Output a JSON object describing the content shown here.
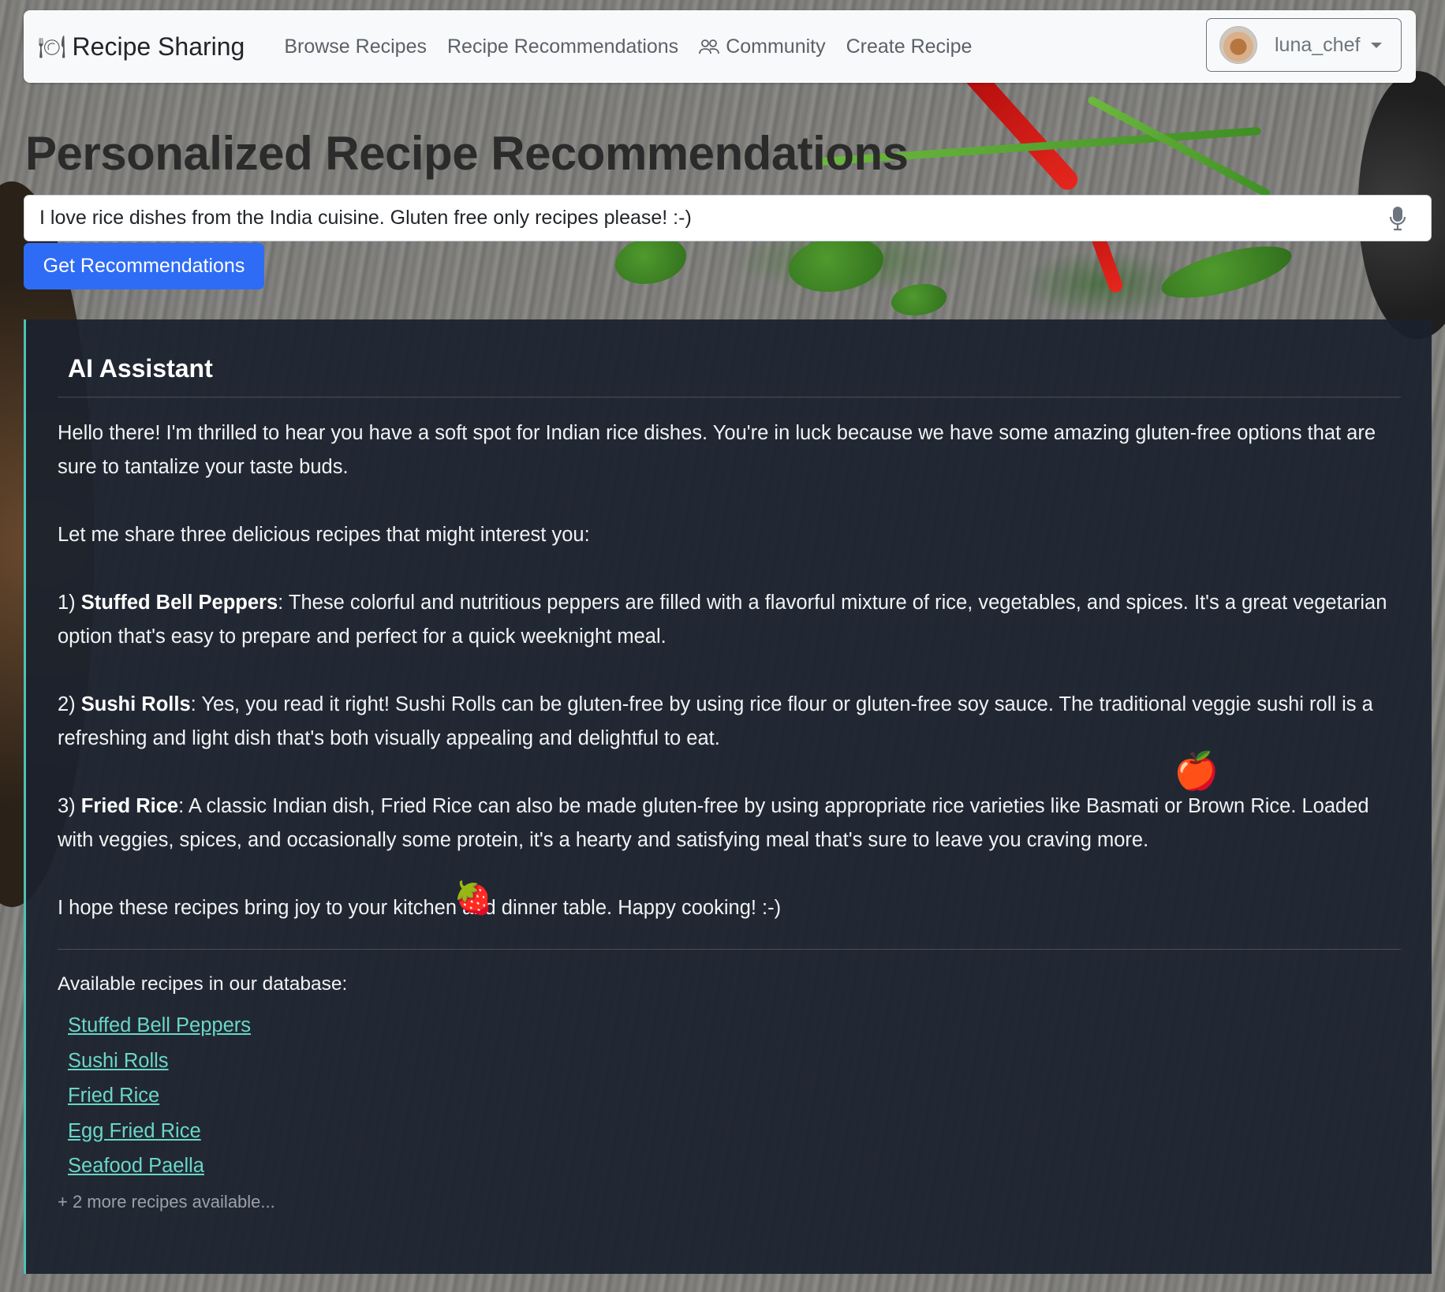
{
  "navbar": {
    "brand": "Recipe Sharing",
    "links": [
      {
        "label": "Browse Recipes"
      },
      {
        "label": "Recipe Recommendations"
      },
      {
        "label": "Community"
      },
      {
        "label": "Create Recipe"
      }
    ],
    "user": {
      "name": "luna_chef"
    }
  },
  "page": {
    "title": "Personalized Recipe Recommendations"
  },
  "search": {
    "value": "I love rice dishes from the India cuisine. Gluten free only recipes please! :-)",
    "button_label": "Get Recommendations"
  },
  "assistant": {
    "heading": "AI Assistant",
    "intro": "Hello there! I'm thrilled to hear you have a soft spot for Indian rice dishes. You're in luck because we have some amazing gluten-free options that are sure to tantalize your taste buds.",
    "lead": "Let me share three delicious recipes that might interest you:",
    "recommendations": [
      {
        "num": "1)",
        "name": "Stuffed Bell Peppers",
        "text": ": These colorful and nutritious peppers are filled with a flavorful mixture of rice, vegetables, and spices. It's a great vegetarian option that's easy to prepare and perfect for a quick weeknight meal."
      },
      {
        "num": "2)",
        "name": "Sushi Rolls",
        "text": ": Yes, you read it right! Sushi Rolls can be gluten-free by using rice flour or gluten-free soy sauce. The traditional veggie sushi roll is a refreshing and light dish that's both visually appealing and delightful to eat."
      },
      {
        "num": "3)",
        "name": "Fried Rice",
        "text": ": A classic Indian dish, Fried Rice can also be made gluten-free by using appropriate rice varieties like Basmati or Brown Rice. Loaded with veggies, spices, and occasionally some protein, it's a hearty and satisfying meal that's sure to leave you craving more."
      }
    ],
    "closing": "I hope these recipes bring joy to your kitchen and dinner table. Happy cooking! :-)",
    "available_label": "Available recipes in our database:",
    "available_recipes": [
      "Stuffed Bell Peppers",
      "Sushi Rolls",
      "Fried Rice",
      "Egg Fried Rice",
      "Seafood Paella"
    ],
    "more_text": "+ 2 more recipes available..."
  },
  "icons": {
    "brand": "plate-icon",
    "community": "people-icon",
    "search": "microphone-icon"
  },
  "colors": {
    "primary_button": "#2f6cf5",
    "link": "#6ad6c8",
    "panel": "#1b212d",
    "accent_border": "#4fc1b5"
  }
}
